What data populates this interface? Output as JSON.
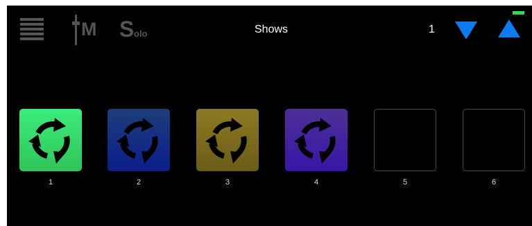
{
  "toolbar": {
    "menu_icon": "hamburger-menu-icon",
    "mix_label": "M",
    "mix_icon": "fader-icon",
    "solo_big": "S",
    "solo_small": "olo",
    "title": "Shows",
    "page_number": "1",
    "page_down_icon": "triangle-down-icon",
    "page_up_icon": "triangle-up-icon",
    "status_color": "#3bd45c"
  },
  "shows": [
    {
      "label": "1",
      "state": "loaded",
      "gradient": [
        "#3cec7a",
        "#2ec55a"
      ],
      "icon": "cycle-arrows-icon"
    },
    {
      "label": "2",
      "state": "loaded",
      "gradient": [
        "#1f3d7a",
        "#091e8c"
      ],
      "icon": "cycle-arrows-icon"
    },
    {
      "label": "3",
      "state": "loaded",
      "gradient": [
        "#8e7a23",
        "#6b5c18"
      ],
      "icon": "cycle-arrows-icon"
    },
    {
      "label": "4",
      "state": "loaded",
      "gradient": [
        "#4d2f96",
        "#3a16a8"
      ],
      "icon": "cycle-arrows-icon"
    },
    {
      "label": "5",
      "state": "empty"
    },
    {
      "label": "6",
      "state": "empty"
    }
  ],
  "colors": {
    "background": "#000000",
    "accent": "#0a7cf0",
    "inactive_icon": "#555555"
  }
}
